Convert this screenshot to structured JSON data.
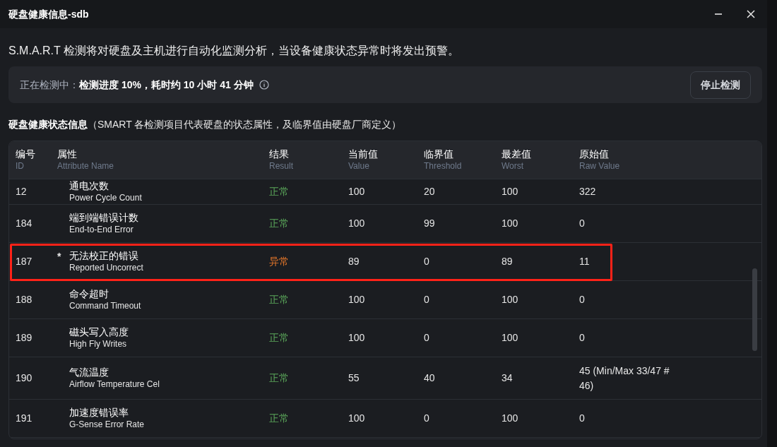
{
  "window": {
    "title": "硬盘健康信息-sdb"
  },
  "description": "S.M.A.R.T 检测将对硬盘及主机进行自动化监测分析，当设备健康状态异常时将发出预警。",
  "status_panel": {
    "label": "正在检测中：",
    "detail": "检测进度 10%，耗时约 10 小时 41 分钟",
    "button": "停止检测"
  },
  "section_title": "硬盘健康状态信息",
  "section_note": "（SMART 各检测项目代表硬盘的状态属性，及临界值由硬盘厂商定义）",
  "table": {
    "columns": [
      {
        "title": "编号",
        "subtitle": "ID"
      },
      {
        "title": "属性",
        "subtitle": "Attribute Name"
      },
      {
        "title": "结果",
        "subtitle": "Result"
      },
      {
        "title": "当前值",
        "subtitle": "Value"
      },
      {
        "title": "临界值",
        "subtitle": "Threshold"
      },
      {
        "title": "最差值",
        "subtitle": "Worst"
      },
      {
        "title": "原始值",
        "subtitle": "Raw Value"
      }
    ],
    "rows": [
      {
        "id": "12",
        "name_zh": "通电次数",
        "name_en": "Power Cycle Count",
        "result": "正常",
        "kind": "normal",
        "value": "100",
        "threshold": "20",
        "worst": "100",
        "raw": "322",
        "highlighted": false
      },
      {
        "id": "184",
        "name_zh": "端到端错误计数",
        "name_en": "End-to-End Error",
        "result": "正常",
        "kind": "normal",
        "value": "100",
        "threshold": "99",
        "worst": "100",
        "raw": "0",
        "highlighted": false
      },
      {
        "id": "187",
        "mark": "*",
        "name_zh": "无法校正的错误",
        "name_en": "Reported Uncorrect",
        "result": "异常",
        "kind": "abnormal",
        "value": "89",
        "threshold": "0",
        "worst": "89",
        "raw": "11",
        "highlighted": true
      },
      {
        "id": "188",
        "name_zh": "命令超时",
        "name_en": "Command Timeout",
        "result": "正常",
        "kind": "normal",
        "value": "100",
        "threshold": "0",
        "worst": "100",
        "raw": "0",
        "highlighted": false
      },
      {
        "id": "189",
        "name_zh": "磁头写入高度",
        "name_en": "High Fly Writes",
        "result": "正常",
        "kind": "normal",
        "value": "100",
        "threshold": "0",
        "worst": "100",
        "raw": "0",
        "highlighted": false
      },
      {
        "id": "190",
        "name_zh": "气流温度",
        "name_en": "Airflow Temperature Cel",
        "result": "正常",
        "kind": "normal",
        "value": "55",
        "threshold": "40",
        "worst": "34",
        "raw": "45 (Min/Max 33/47 # 46)",
        "highlighted": false
      },
      {
        "id": "191",
        "name_zh": "加速度错误率",
        "name_en": "G-Sense Error Rate",
        "result": "正常",
        "kind": "normal",
        "value": "100",
        "threshold": "0",
        "worst": "100",
        "raw": "0",
        "highlighted": false
      }
    ]
  }
}
